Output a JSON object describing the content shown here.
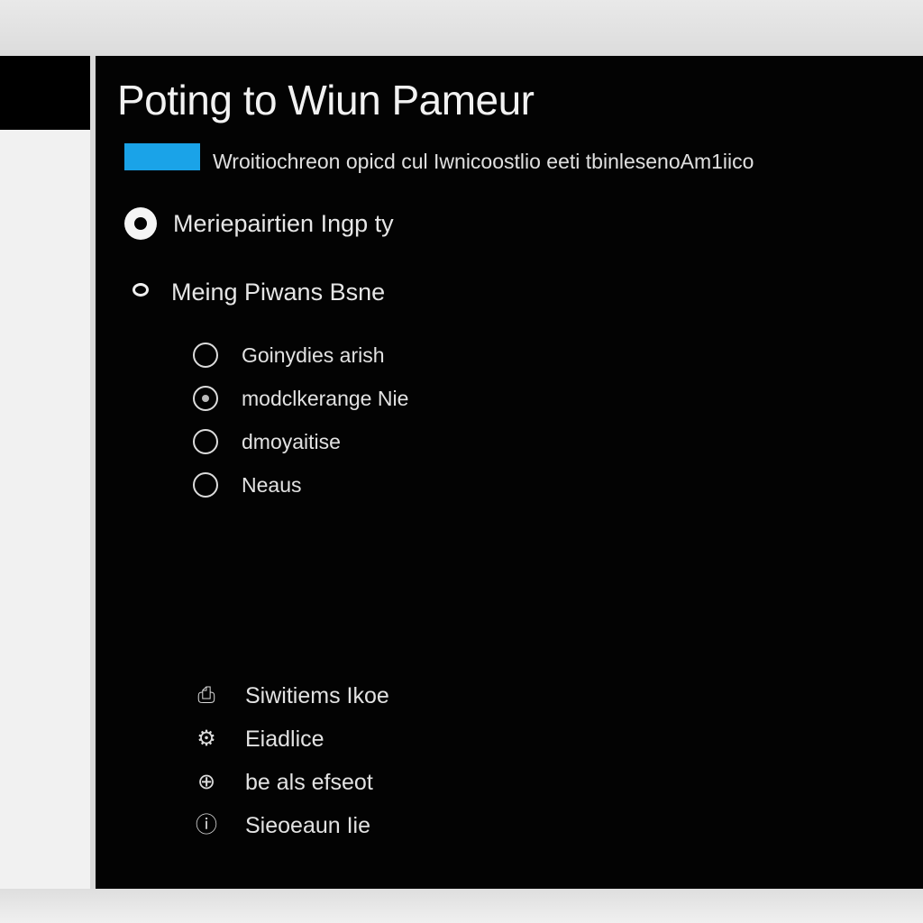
{
  "window": {
    "title": "Poting to Wiun Pameur"
  },
  "accent_color": "#1aa3e8",
  "main": {
    "description": "Wroitiochreon opicd cul Iwnicoostlio eeti tbinlesenoAm1iico",
    "primary_option": {
      "label": "Meriepairtien Ingp ty",
      "icon": "radio-selected-icon"
    },
    "section": {
      "label": "Meing Piwans Bsne",
      "icon": "chevron-down-icon"
    },
    "sub_options": [
      {
        "label": "Goinydies arish",
        "icon": "radio-icon"
      },
      {
        "label": "modclkerange Nie",
        "icon": "radio-icon"
      },
      {
        "label": "dmoyaitise",
        "icon": "radio-icon"
      },
      {
        "label": "Neaus",
        "icon": "radio-icon"
      }
    ],
    "footer_items": [
      {
        "label": "Siwitiems Ikoe",
        "icon": "printer-icon",
        "glyph": "⎙"
      },
      {
        "label": "Eiadlice",
        "icon": "settings-icon",
        "glyph": "⚙"
      },
      {
        "label": "be als efseot",
        "icon": "globe-icon",
        "glyph": "⊕"
      },
      {
        "label": "Sieoeaun Iie",
        "icon": "info-icon",
        "glyph": "ⓘ"
      }
    ]
  }
}
